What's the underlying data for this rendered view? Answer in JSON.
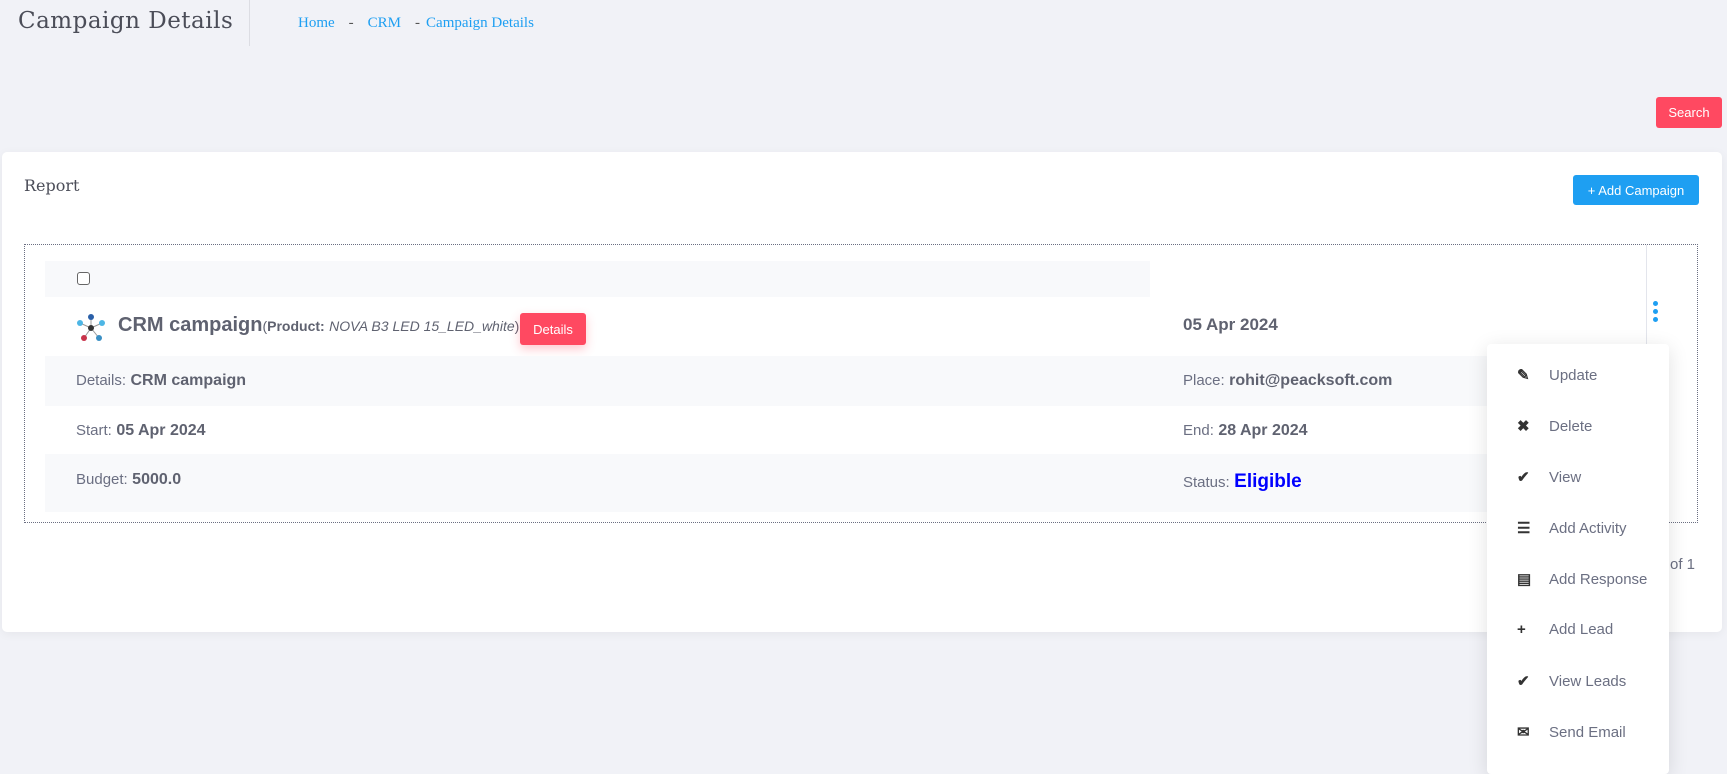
{
  "header": {
    "title": "Campaign Details",
    "breadcrumb": [
      "Home",
      "CRM",
      "Campaign Details"
    ],
    "separator": "-"
  },
  "search_label": "Search",
  "card": {
    "title": "Report",
    "add_label": "+ Add Campaign"
  },
  "campaign": {
    "name": "CRM campaign",
    "product_prefix": "( ",
    "product_label": "Product:",
    "product": "NOVA B3 LED 15_LED_white",
    "product_suffix": ")",
    "details_btn": "Details",
    "date": "05 Apr 2024",
    "details_label": "Details:",
    "details": "CRM campaign",
    "place_label": "Place:",
    "place": "rohit@peacksoft.com",
    "start_label": "Start:",
    "start": "05 Apr 2024",
    "end_label": "End:",
    "end": "28 Apr 2024",
    "budget_label": "Budget:",
    "budget": "5000.0",
    "status_label": "Status:",
    "status": "Eligible",
    "status_color": "#0000ff"
  },
  "pagination": "of  1",
  "menu": [
    {
      "icon": "pencil-icon",
      "glyph": "✎",
      "label": "Update"
    },
    {
      "icon": "close-icon",
      "glyph": "✖",
      "label": "Delete"
    },
    {
      "icon": "check-icon",
      "glyph": "✔",
      "label": "View"
    },
    {
      "icon": "tasks-icon",
      "glyph": "☰",
      "label": "Add Activity"
    },
    {
      "icon": "list-alt-icon",
      "glyph": "▤",
      "label": "Add Response"
    },
    {
      "icon": "plus-icon",
      "glyph": "+",
      "label": "Add Lead"
    },
    {
      "icon": "check-icon",
      "glyph": "✔",
      "label": "View Leads"
    },
    {
      "icon": "envelope-icon",
      "glyph": "✉",
      "label": "Send Email"
    }
  ]
}
